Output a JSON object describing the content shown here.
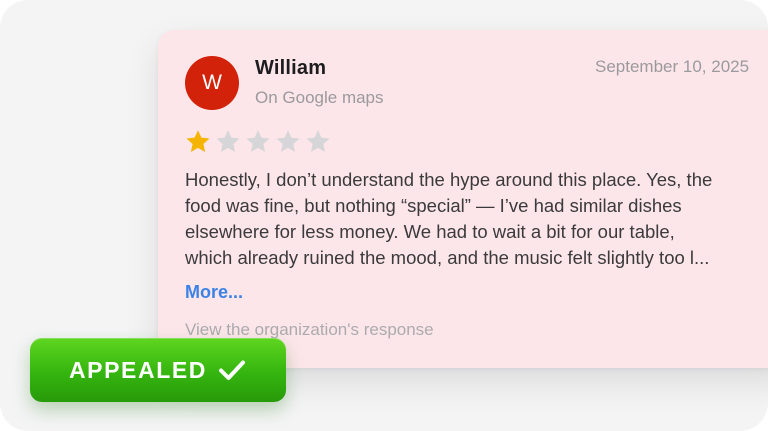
{
  "review": {
    "avatar_initial": "W",
    "author_name": "William",
    "source": "On Google maps",
    "date": "September 10, 2025",
    "rating": 1,
    "rating_max": 5,
    "text_lines": [
      "Honestly, I don’t understand the hype around this place. Yes, the",
      "food was fine, but nothing “special” — I’ve had similar dishes",
      "elsewhere for less money. We had to wait a bit for our table,",
      "which already ruined the mood, and the music felt slightly too l..."
    ],
    "more_label": "More...",
    "response_link": "View the organization's response"
  },
  "badge": {
    "label": "APPEALED",
    "icon": "check-icon"
  },
  "colors": {
    "card_background": "#fde6ea",
    "avatar": "#d3220a",
    "star_filled": "#f5b400",
    "star_empty": "#d6d6d8",
    "link": "#3b82e6",
    "badge_green": "#35b50f"
  }
}
